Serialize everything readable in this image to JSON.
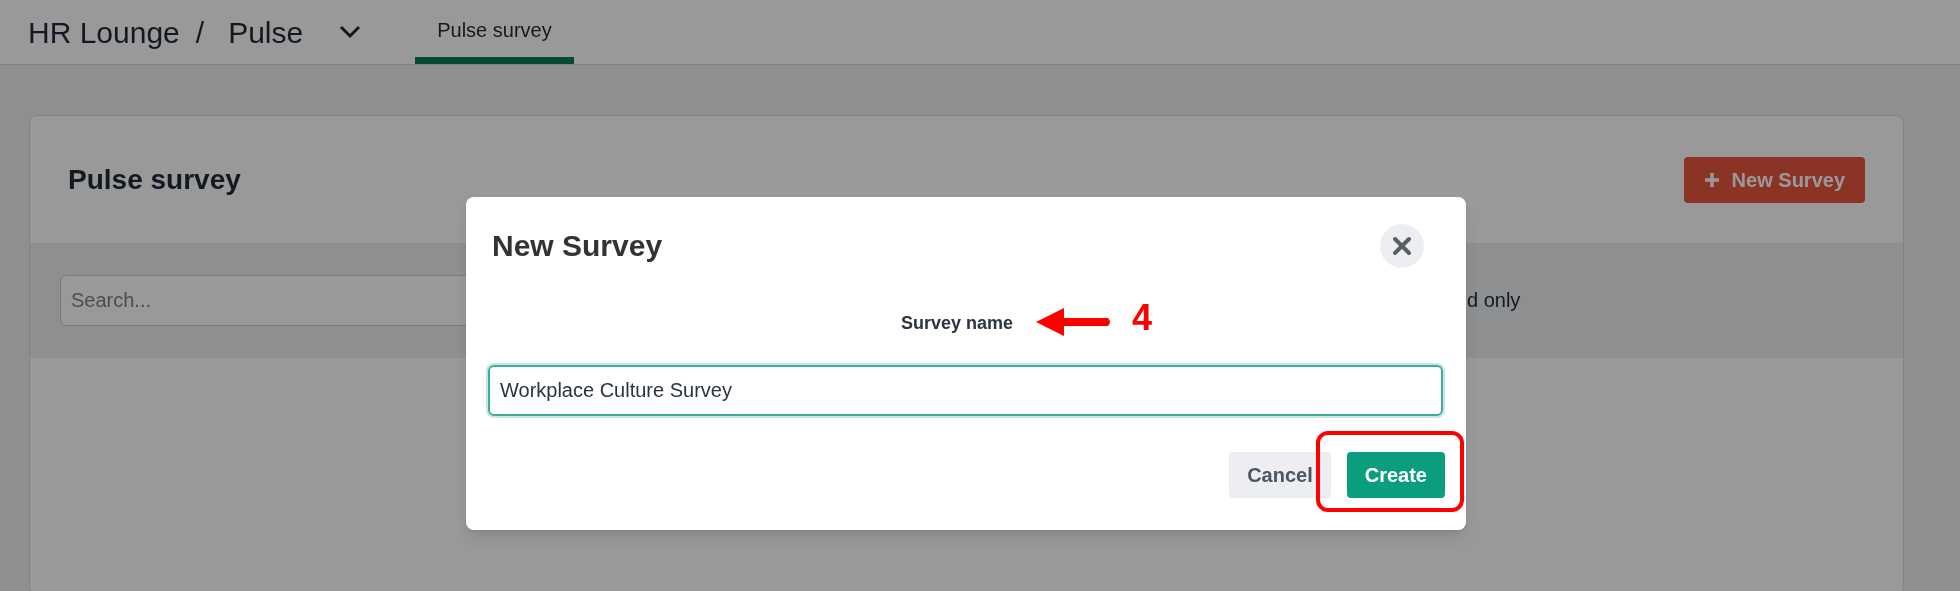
{
  "breadcrumb": {
    "workspace": "HR Lounge",
    "separator": "/",
    "module": "Pulse"
  },
  "tabs": [
    {
      "label": "Pulse survey",
      "selected": true
    }
  ],
  "card": {
    "title": "Pulse survey",
    "new_button": "New Survey",
    "filter": {
      "search_placeholder": "Search...",
      "partial_text": "d only"
    }
  },
  "dialog": {
    "title": "New Survey",
    "field_label": "Survey name",
    "field_value": "Workplace Culture Survey",
    "buttons": [
      {
        "label": "Cancel",
        "kind": "secondary"
      },
      {
        "label": "Create",
        "kind": "primary"
      }
    ]
  },
  "annotations": {
    "step_number": "4",
    "highlight": true
  }
}
